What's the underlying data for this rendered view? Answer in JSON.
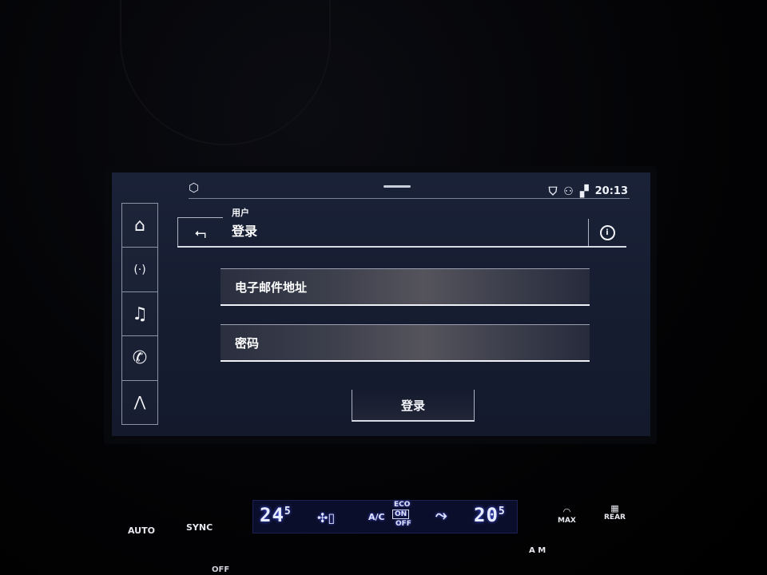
{
  "status_bar": {
    "time": "20:13"
  },
  "nav": {
    "items": [
      {
        "id": "home",
        "glyph": "⌂"
      },
      {
        "id": "radio",
        "glyph": "(·)"
      },
      {
        "id": "music",
        "glyph": "♫"
      },
      {
        "id": "phone",
        "glyph": "✆"
      },
      {
        "id": "navigation",
        "glyph": "⋀"
      }
    ]
  },
  "header": {
    "subtitle": "用户",
    "title": "登录",
    "back_glyph": "⮢",
    "info_glyph": "i"
  },
  "form": {
    "email_label": "电子邮件地址",
    "password_label": "密码",
    "login_button": "登录"
  },
  "climate": {
    "auto": "AUTO",
    "sync": "SYNC",
    "temp_left_main": "24",
    "temp_left_dec": "5",
    "ac": "A/C",
    "eco": "ECO",
    "on": "ON",
    "off_small": "OFF",
    "temp_right_main": "20",
    "temp_right_dec": "5",
    "max": "MAX",
    "rear": "REAR",
    "am": "A M",
    "off": "OFF"
  },
  "colors": {
    "screen_bg": "#161d31",
    "accent_text": "#ffffff",
    "climate_display": "#0b0e2a"
  }
}
